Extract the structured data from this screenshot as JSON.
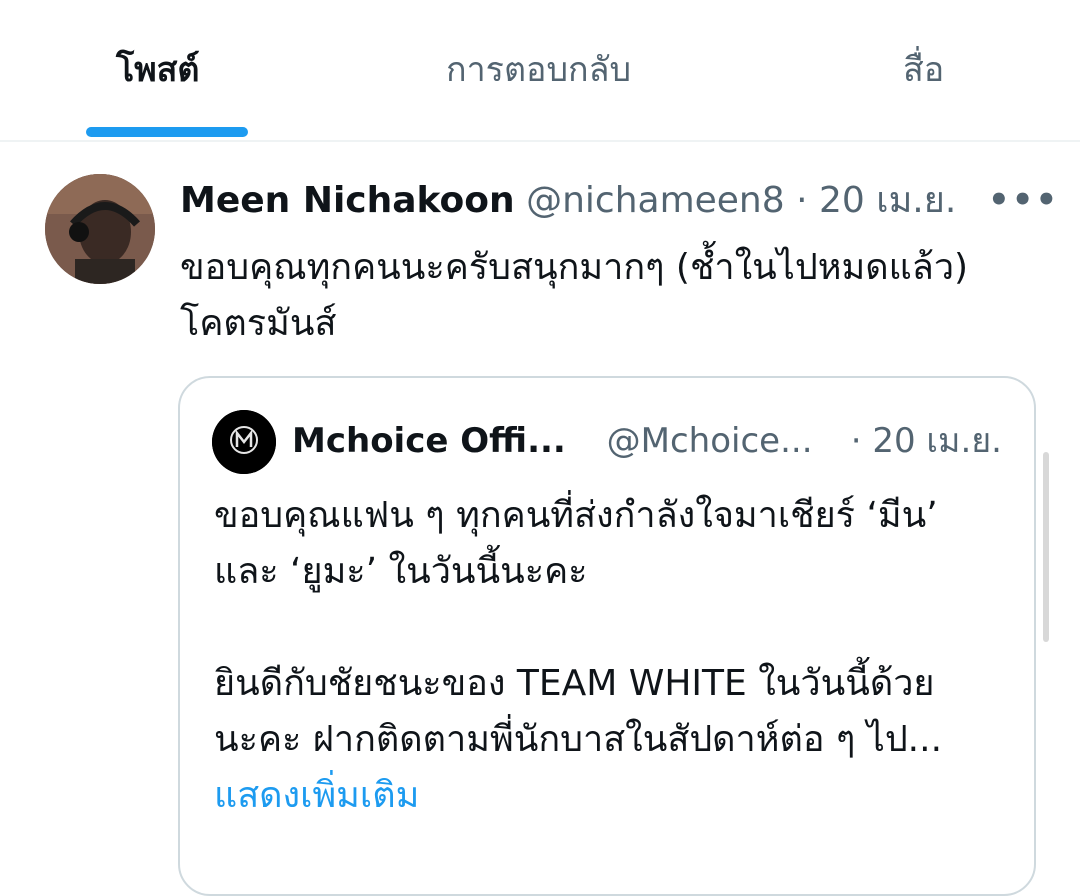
{
  "tabs": [
    {
      "label": "โพสต์",
      "active": true
    },
    {
      "label": "การตอบกลับ",
      "active": false
    },
    {
      "label": "สื่อ",
      "active": false
    }
  ],
  "tweet": {
    "name": "Meen Nichakoon",
    "handle": "@nichameen8",
    "separator": "·",
    "time": "20 เม.ย.",
    "more": "•••",
    "text_line1": "ขอบคุณทุกคนนะครับสนุกมากๆ (ช้ำในไปหมดแล้ว)",
    "text_line2": "โคตรมันส์"
  },
  "quote": {
    "name": "Mchoice Offi...",
    "handle": "@Mchoice...",
    "time": "· 20 เม.ย.",
    "line1": "ขอบคุณแฟน ๆ ทุกคนที่ส่งกำลังใจมาเชียร์ ‘มีน’",
    "line2": "และ ‘ยูมะ’ ในวันนี้นะคะ",
    "line3": "ยินดีกับชัยชนะของ TEAM WHITE ในวันนี้ด้วย",
    "line4": "นะคะ ฝากติดตามพี่นักบาสในสัปดาห์ต่อ ๆ ไป...",
    "show_more": "แสดงเพิ่มเติม"
  },
  "colors": {
    "accent": "#1d9bf0",
    "secondary_text": "#536471",
    "border": "#cfd9de"
  },
  "icons": {
    "more": "more-horizontal-icon"
  }
}
